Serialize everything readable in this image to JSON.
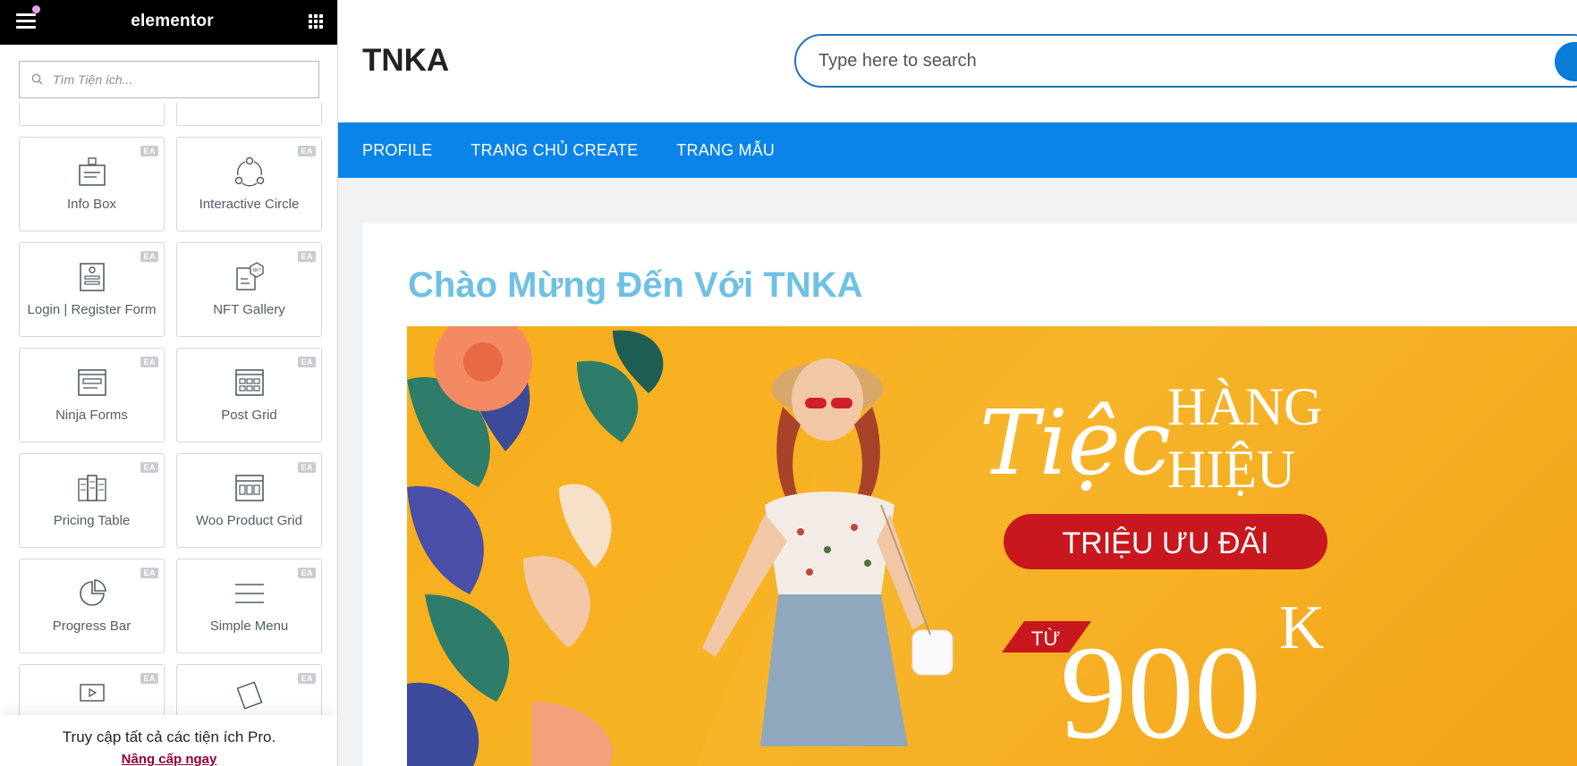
{
  "editor": {
    "logo": "elementor",
    "search_placeholder": "Tìm Tiện ích...",
    "badge": "EA",
    "widgets": [
      {
        "label": "Info Box",
        "icon": "info-box-icon"
      },
      {
        "label": "Interactive Circle",
        "icon": "interactive-circle-icon"
      },
      {
        "label": "Login | Register Form",
        "icon": "login-form-icon"
      },
      {
        "label": "NFT Gallery",
        "icon": "nft-gallery-icon"
      },
      {
        "label": "Ninja Forms",
        "icon": "ninja-forms-icon"
      },
      {
        "label": "Post Grid",
        "icon": "post-grid-icon"
      },
      {
        "label": "Pricing Table",
        "icon": "pricing-table-icon"
      },
      {
        "label": "Woo Product Grid",
        "icon": "woo-product-grid-icon"
      },
      {
        "label": "Progress Bar",
        "icon": "progress-bar-icon"
      },
      {
        "label": "Simple Menu",
        "icon": "simple-menu-icon"
      }
    ],
    "pro": {
      "text": "Truy cập tất cả các tiện ích Pro.",
      "link": "Nâng cấp ngay"
    }
  },
  "site": {
    "title": "TNKA",
    "search_placeholder": "Type here to search",
    "nav": [
      "PROFILE",
      "TRANG CHỦ CREATE",
      "TRANG MẪU"
    ],
    "welcome": "Chào Mừng Đến Với TNKA",
    "banner": {
      "script": "Tiệc",
      "line1": "HÀNG",
      "line2": "HIỆU",
      "pill": "TRIỆU ƯU ĐÃI",
      "from": "TỪ",
      "price": "900",
      "unit": "K"
    }
  },
  "colors": {
    "accent_blue": "#0a84e8",
    "welcome_color": "#6ec1e4",
    "banner_orange": "#f8a61a",
    "pill_red": "#c8171e",
    "upgrade_link": "#93003c"
  }
}
